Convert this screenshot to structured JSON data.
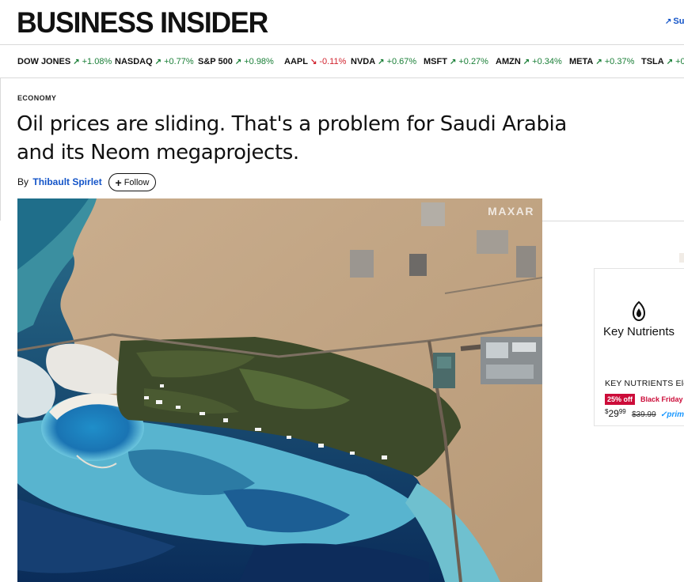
{
  "header": {
    "logo": "BUSINESS INSIDER",
    "subscribe_label": "Sub"
  },
  "ticker": [
    {
      "symbol": "DOW JONES",
      "direction": "up",
      "change": "+1.08%"
    },
    {
      "symbol": "NASDAQ",
      "direction": "up",
      "change": "+0.77%"
    },
    {
      "symbol": "S&P 500",
      "direction": "up",
      "change": "+0.98%"
    },
    {
      "symbol": "AAPL",
      "direction": "down",
      "change": "-0.11%"
    },
    {
      "symbol": "NVDA",
      "direction": "up",
      "change": "+0.67%"
    },
    {
      "symbol": "MSFT",
      "direction": "up",
      "change": "+0.27%"
    },
    {
      "symbol": "AMZN",
      "direction": "up",
      "change": "+0.34%"
    },
    {
      "symbol": "META",
      "direction": "up",
      "change": "+0.37%"
    },
    {
      "symbol": "TSLA",
      "direction": "up",
      "change": "+0"
    }
  ],
  "article": {
    "category": "ECONOMY",
    "headline_line1": "Oil prices are sliding. That's a problem for Saudi Arabia",
    "headline_line2": "and its Neom megaprojects.",
    "byline_prefix": "By",
    "author": "Thibault Spirlet",
    "follow_label": "Follow",
    "image_credit": "MAXAR"
  },
  "ad": {
    "brand": "Key Nutrients",
    "title": "KEY NUTRIENTS Ele",
    "badge": "25% off",
    "deal": "Black Friday D",
    "price_currency": "$",
    "price_whole": "29",
    "price_cents": "99",
    "price_old": "$39.99",
    "prime": "prime"
  },
  "colors": {
    "link_blue": "#1354c8",
    "up_green": "#1a7f37",
    "down_red": "#d1242f",
    "deal_red": "#cc0c39"
  }
}
